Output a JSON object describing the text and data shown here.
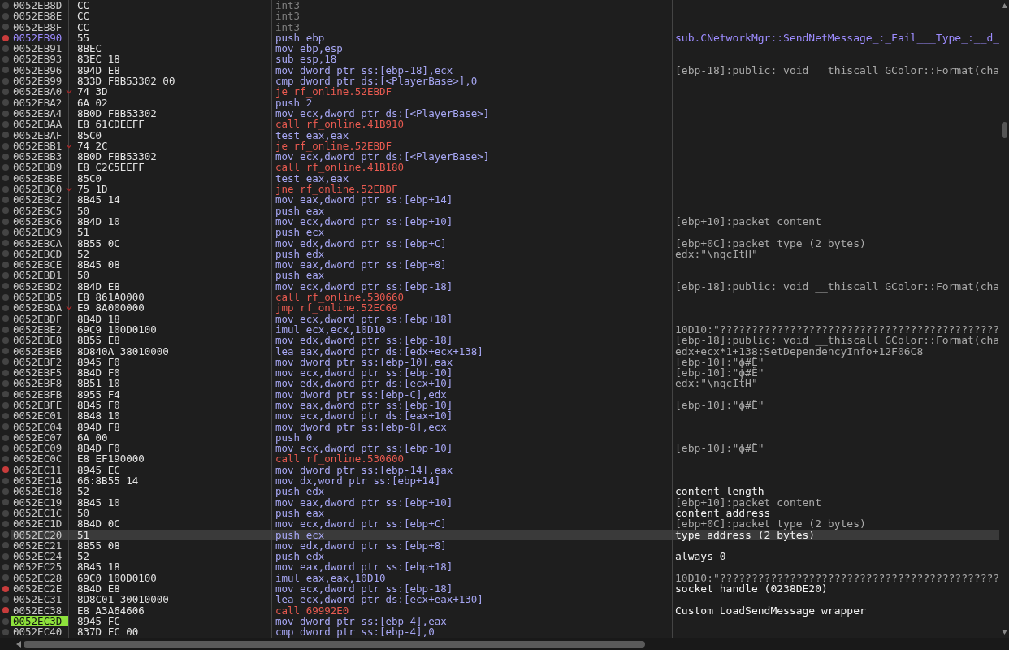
{
  "rows": [
    {
      "address": "0052EB8D",
      "bytes": "CC",
      "instruction": "int3",
      "kind": "padding",
      "breakpoint": false,
      "selected": false,
      "current": false,
      "labeled": false
    },
    {
      "address": "0052EB8E",
      "bytes": "CC",
      "instruction": "int3",
      "kind": "padding",
      "breakpoint": false,
      "selected": false,
      "current": false,
      "labeled": false
    },
    {
      "address": "0052EB8F",
      "bytes": "CC",
      "instruction": "int3",
      "kind": "padding",
      "breakpoint": false,
      "selected": false,
      "current": false,
      "labeled": false
    },
    {
      "address": "0052EB90",
      "bytes": "55",
      "instruction": "push ebp",
      "kind": "normal",
      "breakpoint": true,
      "selected": false,
      "current": false,
      "labeled": true,
      "comment": {
        "kind": "label",
        "text": "sub.CNetworkMgr::SendNetMessage_:_Fail___Type_:__d_"
      }
    },
    {
      "address": "0052EB91",
      "bytes": "8BEC",
      "instruction": "mov ebp,esp",
      "kind": "normal",
      "breakpoint": false,
      "selected": false,
      "current": false,
      "labeled": false
    },
    {
      "address": "0052EB93",
      "bytes": "83EC 18",
      "instruction": "sub esp,18",
      "kind": "normal",
      "breakpoint": false,
      "selected": false,
      "current": false,
      "labeled": false
    },
    {
      "address": "0052EB96",
      "bytes": "894D E8",
      "instruction": "mov dword ptr ss:[ebp-18],ecx",
      "kind": "normal",
      "breakpoint": false,
      "selected": false,
      "current": false,
      "labeled": false,
      "comment": {
        "kind": "auto",
        "text": "[ebp-18]:public: void __thiscall GColor::Format(cha"
      }
    },
    {
      "address": "0052EB99",
      "bytes": "833D F8B53302 00",
      "instruction": "cmp dword ptr ds:[<PlayerBase>],0",
      "kind": "normal",
      "breakpoint": false,
      "selected": false,
      "current": false,
      "labeled": false
    },
    {
      "address": "0052EBA0",
      "bytes": "74 3D",
      "instruction": "je rf_online.52EBDF",
      "kind": "jump",
      "breakpoint": false,
      "selected": false,
      "current": false,
      "labeled": false
    },
    {
      "address": "0052EBA2",
      "bytes": "6A 02",
      "instruction": "push 2",
      "kind": "normal",
      "breakpoint": false,
      "selected": false,
      "current": false,
      "labeled": false
    },
    {
      "address": "0052EBA4",
      "bytes": "8B0D F8B53302",
      "instruction": "mov ecx,dword ptr ds:[<PlayerBase>]",
      "kind": "normal",
      "breakpoint": false,
      "selected": false,
      "current": false,
      "labeled": false
    },
    {
      "address": "0052EBAA",
      "bytes": "E8 61CDEEFF",
      "instruction": "call rf_online.41B910",
      "kind": "call",
      "breakpoint": false,
      "selected": false,
      "current": false,
      "labeled": false
    },
    {
      "address": "0052EBAF",
      "bytes": "85C0",
      "instruction": "test eax,eax",
      "kind": "normal",
      "breakpoint": false,
      "selected": false,
      "current": false,
      "labeled": false
    },
    {
      "address": "0052EBB1",
      "bytes": "74 2C",
      "instruction": "je rf_online.52EBDF",
      "kind": "jump",
      "breakpoint": false,
      "selected": false,
      "current": false,
      "labeled": false
    },
    {
      "address": "0052EBB3",
      "bytes": "8B0D F8B53302",
      "instruction": "mov ecx,dword ptr ds:[<PlayerBase>]",
      "kind": "normal",
      "breakpoint": false,
      "selected": false,
      "current": false,
      "labeled": false
    },
    {
      "address": "0052EBB9",
      "bytes": "E8 C2C5EEFF",
      "instruction": "call rf_online.41B180",
      "kind": "call",
      "breakpoint": false,
      "selected": false,
      "current": false,
      "labeled": false
    },
    {
      "address": "0052EBBE",
      "bytes": "85C0",
      "instruction": "test eax,eax",
      "kind": "normal",
      "breakpoint": false,
      "selected": false,
      "current": false,
      "labeled": false
    },
    {
      "address": "0052EBC0",
      "bytes": "75 1D",
      "instruction": "jne rf_online.52EBDF",
      "kind": "jump",
      "breakpoint": false,
      "selected": false,
      "current": false,
      "labeled": false
    },
    {
      "address": "0052EBC2",
      "bytes": "8B45 14",
      "instruction": "mov eax,dword ptr ss:[ebp+14]",
      "kind": "normal",
      "breakpoint": false,
      "selected": false,
      "current": false,
      "labeled": false
    },
    {
      "address": "0052EBC5",
      "bytes": "50",
      "instruction": "push eax",
      "kind": "normal",
      "breakpoint": false,
      "selected": false,
      "current": false,
      "labeled": false
    },
    {
      "address": "0052EBC6",
      "bytes": "8B4D 10",
      "instruction": "mov ecx,dword ptr ss:[ebp+10]",
      "kind": "normal",
      "breakpoint": false,
      "selected": false,
      "current": false,
      "labeled": false,
      "comment": {
        "kind": "auto",
        "text": "[ebp+10]:packet content"
      }
    },
    {
      "address": "0052EBC9",
      "bytes": "51",
      "instruction": "push ecx",
      "kind": "normal",
      "breakpoint": false,
      "selected": false,
      "current": false,
      "labeled": false
    },
    {
      "address": "0052EBCA",
      "bytes": "8B55 0C",
      "instruction": "mov edx,dword ptr ss:[ebp+C]",
      "kind": "normal",
      "breakpoint": false,
      "selected": false,
      "current": false,
      "labeled": false,
      "comment": {
        "kind": "auto",
        "text": "[ebp+0C]:packet type (2 bytes)"
      }
    },
    {
      "address": "0052EBCD",
      "bytes": "52",
      "instruction": "push edx",
      "kind": "normal",
      "breakpoint": false,
      "selected": false,
      "current": false,
      "labeled": false,
      "comment": {
        "kind": "auto",
        "text": "edx:\"\\nqcItH\""
      }
    },
    {
      "address": "0052EBCE",
      "bytes": "8B45 08",
      "instruction": "mov eax,dword ptr ss:[ebp+8]",
      "kind": "normal",
      "breakpoint": false,
      "selected": false,
      "current": false,
      "labeled": false
    },
    {
      "address": "0052EBD1",
      "bytes": "50",
      "instruction": "push eax",
      "kind": "normal",
      "breakpoint": false,
      "selected": false,
      "current": false,
      "labeled": false
    },
    {
      "address": "0052EBD2",
      "bytes": "8B4D E8",
      "instruction": "mov ecx,dword ptr ss:[ebp-18]",
      "kind": "normal",
      "breakpoint": false,
      "selected": false,
      "current": false,
      "labeled": false,
      "comment": {
        "kind": "auto",
        "text": "[ebp-18]:public: void __thiscall GColor::Format(cha"
      }
    },
    {
      "address": "0052EBD5",
      "bytes": "E8 861A0000",
      "instruction": "call rf_online.530660",
      "kind": "call",
      "breakpoint": false,
      "selected": false,
      "current": false,
      "labeled": false
    },
    {
      "address": "0052EBDA",
      "bytes": "E9 8A000000",
      "instruction": "jmp rf_online.52EC69",
      "kind": "jump",
      "breakpoint": false,
      "selected": false,
      "current": false,
      "labeled": false
    },
    {
      "address": "0052EBDF",
      "bytes": "8B4D 18",
      "instruction": "mov ecx,dword ptr ss:[ebp+18]",
      "kind": "normal",
      "breakpoint": false,
      "selected": false,
      "current": false,
      "labeled": false
    },
    {
      "address": "0052EBE2",
      "bytes": "69C9 100D0100",
      "instruction": "imul ecx,ecx,10D10",
      "kind": "normal",
      "breakpoint": false,
      "selected": false,
      "current": false,
      "labeled": false,
      "comment": {
        "kind": "auto",
        "text": "10D10:\"????????????????????????????????????????????"
      }
    },
    {
      "address": "0052EBE8",
      "bytes": "8B55 E8",
      "instruction": "mov edx,dword ptr ss:[ebp-18]",
      "kind": "normal",
      "breakpoint": false,
      "selected": false,
      "current": false,
      "labeled": false,
      "comment": {
        "kind": "auto",
        "text": "[ebp-18]:public: void __thiscall GColor::Format(cha"
      }
    },
    {
      "address": "0052EBEB",
      "bytes": "8D840A 38010000",
      "instruction": "lea eax,dword ptr ds:[edx+ecx+138]",
      "kind": "normal",
      "breakpoint": false,
      "selected": false,
      "current": false,
      "labeled": false,
      "comment": {
        "kind": "auto",
        "text": "edx+ecx*1+138:SetDependencyInfo+12F06C8"
      }
    },
    {
      "address": "0052EBF2",
      "bytes": "8945 F0",
      "instruction": "mov dword ptr ss:[ebp-10],eax",
      "kind": "normal",
      "breakpoint": false,
      "selected": false,
      "current": false,
      "labeled": false,
      "comment": {
        "kind": "auto",
        "text": "[ebp-10]:\"ϕ#Ë\""
      }
    },
    {
      "address": "0052EBF5",
      "bytes": "8B4D F0",
      "instruction": "mov ecx,dword ptr ss:[ebp-10]",
      "kind": "normal",
      "breakpoint": false,
      "selected": false,
      "current": false,
      "labeled": false,
      "comment": {
        "kind": "auto",
        "text": "[ebp-10]:\"ϕ#Ë\""
      }
    },
    {
      "address": "0052EBF8",
      "bytes": "8B51 10",
      "instruction": "mov edx,dword ptr ds:[ecx+10]",
      "kind": "normal",
      "breakpoint": false,
      "selected": false,
      "current": false,
      "labeled": false,
      "comment": {
        "kind": "auto",
        "text": "edx:\"\\nqcItH\""
      }
    },
    {
      "address": "0052EBFB",
      "bytes": "8955 F4",
      "instruction": "mov dword ptr ss:[ebp-C],edx",
      "kind": "normal",
      "breakpoint": false,
      "selected": false,
      "current": false,
      "labeled": false
    },
    {
      "address": "0052EBFE",
      "bytes": "8B45 F0",
      "instruction": "mov eax,dword ptr ss:[ebp-10]",
      "kind": "normal",
      "breakpoint": false,
      "selected": false,
      "current": false,
      "labeled": false,
      "comment": {
        "kind": "auto",
        "text": "[ebp-10]:\"ϕ#Ë\""
      }
    },
    {
      "address": "0052EC01",
      "bytes": "8B48 10",
      "instruction": "mov ecx,dword ptr ds:[eax+10]",
      "kind": "normal",
      "breakpoint": false,
      "selected": false,
      "current": false,
      "labeled": false
    },
    {
      "address": "0052EC04",
      "bytes": "894D F8",
      "instruction": "mov dword ptr ss:[ebp-8],ecx",
      "kind": "normal",
      "breakpoint": false,
      "selected": false,
      "current": false,
      "labeled": false
    },
    {
      "address": "0052EC07",
      "bytes": "6A 00",
      "instruction": "push 0",
      "kind": "normal",
      "breakpoint": false,
      "selected": false,
      "current": false,
      "labeled": false
    },
    {
      "address": "0052EC09",
      "bytes": "8B4D F0",
      "instruction": "mov ecx,dword ptr ss:[ebp-10]",
      "kind": "normal",
      "breakpoint": false,
      "selected": false,
      "current": false,
      "labeled": false,
      "comment": {
        "kind": "auto",
        "text": "[ebp-10]:\"ϕ#Ë\""
      }
    },
    {
      "address": "0052EC0C",
      "bytes": "E8 EF190000",
      "instruction": "call rf_online.530600",
      "kind": "call",
      "breakpoint": false,
      "selected": false,
      "current": false,
      "labeled": false
    },
    {
      "address": "0052EC11",
      "bytes": "8945 EC",
      "instruction": "mov dword ptr ss:[ebp-14],eax",
      "kind": "normal",
      "breakpoint": true,
      "selected": false,
      "current": false,
      "labeled": false
    },
    {
      "address": "0052EC14",
      "bytes": "66:8B55 14",
      "instruction": "mov dx,word ptr ss:[ebp+14]",
      "kind": "normal",
      "breakpoint": false,
      "selected": false,
      "current": false,
      "labeled": false
    },
    {
      "address": "0052EC18",
      "bytes": "52",
      "instruction": "push edx",
      "kind": "normal",
      "breakpoint": false,
      "selected": false,
      "current": false,
      "labeled": false,
      "comment": {
        "kind": "user",
        "text": "content length"
      }
    },
    {
      "address": "0052EC19",
      "bytes": "8B45 10",
      "instruction": "mov eax,dword ptr ss:[ebp+10]",
      "kind": "normal",
      "breakpoint": false,
      "selected": false,
      "current": false,
      "labeled": false,
      "comment": {
        "kind": "auto",
        "text": "[ebp+10]:packet content"
      }
    },
    {
      "address": "0052EC1C",
      "bytes": "50",
      "instruction": "push eax",
      "kind": "normal",
      "breakpoint": false,
      "selected": false,
      "current": false,
      "labeled": false,
      "comment": {
        "kind": "user",
        "text": "content address"
      }
    },
    {
      "address": "0052EC1D",
      "bytes": "8B4D 0C",
      "instruction": "mov ecx,dword ptr ss:[ebp+C]",
      "kind": "normal",
      "breakpoint": false,
      "selected": false,
      "current": false,
      "labeled": false,
      "comment": {
        "kind": "auto",
        "text": "[ebp+0C]:packet type (2 bytes)"
      }
    },
    {
      "address": "0052EC20",
      "bytes": "51",
      "instruction": "push ecx",
      "kind": "normal",
      "breakpoint": false,
      "selected": true,
      "current": false,
      "labeled": false,
      "comment": {
        "kind": "user",
        "text": "type address (2 bytes)"
      }
    },
    {
      "address": "0052EC21",
      "bytes": "8B55 08",
      "instruction": "mov edx,dword ptr ss:[ebp+8]",
      "kind": "normal",
      "breakpoint": false,
      "selected": false,
      "current": false,
      "labeled": false
    },
    {
      "address": "0052EC24",
      "bytes": "52",
      "instruction": "push edx",
      "kind": "normal",
      "breakpoint": false,
      "selected": false,
      "current": false,
      "labeled": false,
      "comment": {
        "kind": "user",
        "text": "always 0"
      }
    },
    {
      "address": "0052EC25",
      "bytes": "8B45 18",
      "instruction": "mov eax,dword ptr ss:[ebp+18]",
      "kind": "normal",
      "breakpoint": false,
      "selected": false,
      "current": false,
      "labeled": false
    },
    {
      "address": "0052EC28",
      "bytes": "69C0 100D0100",
      "instruction": "imul eax,eax,10D10",
      "kind": "normal",
      "breakpoint": false,
      "selected": false,
      "current": false,
      "labeled": false,
      "comment": {
        "kind": "auto",
        "text": "10D10:\"????????????????????????????????????????????"
      }
    },
    {
      "address": "0052EC2E",
      "bytes": "8B4D E8",
      "instruction": "mov ecx,dword ptr ss:[ebp-18]",
      "kind": "normal",
      "breakpoint": true,
      "selected": false,
      "current": false,
      "labeled": false,
      "comment": {
        "kind": "user",
        "text": "socket handle (0238DE20)"
      }
    },
    {
      "address": "0052EC31",
      "bytes": "8D8C01 30010000",
      "instruction": "lea ecx,dword ptr ds:[ecx+eax+130]",
      "kind": "normal",
      "breakpoint": false,
      "selected": false,
      "current": false,
      "labeled": false
    },
    {
      "address": "0052EC38",
      "bytes": "E8 A3A64606",
      "instruction": "call 69992E0",
      "kind": "call",
      "breakpoint": true,
      "selected": false,
      "current": false,
      "labeled": false,
      "comment": {
        "kind": "user",
        "text": "Custom LoadSendMessage wrapper"
      }
    },
    {
      "address": "0052EC3D",
      "bytes": "8945 FC",
      "instruction": "mov dword ptr ss:[ebp-4],eax",
      "kind": "normal",
      "breakpoint": false,
      "selected": false,
      "current": true,
      "labeled": false
    },
    {
      "address": "0052EC40",
      "bytes": "837D FC 00",
      "instruction": "cmp dword ptr ss:[ebp-4],0",
      "kind": "normal",
      "breakpoint": false,
      "selected": false,
      "current": false,
      "labeled": false
    }
  ]
}
